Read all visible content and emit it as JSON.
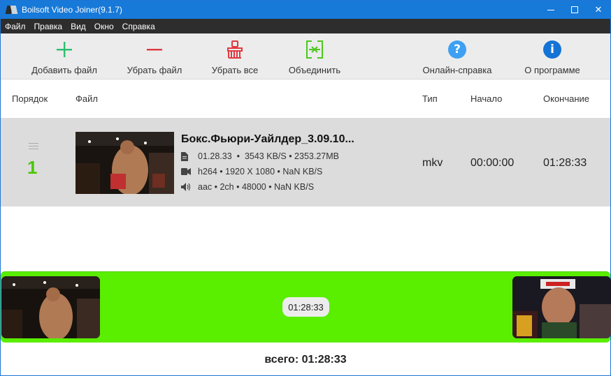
{
  "window": {
    "title": "Boilsoft Video Joiner(9.1.7)",
    "min_icon": "minimize-icon",
    "max_icon": "maximize-icon",
    "close_label": "✕"
  },
  "menu": [
    "Файл",
    "Правка",
    "Вид",
    "Окно",
    "Справка"
  ],
  "toolbar": {
    "add": {
      "label": "Добавить файл",
      "icon": "plus-icon",
      "color": "#2dbd6e"
    },
    "remove": {
      "label": "Убрать файл",
      "icon": "minus-icon",
      "color": "#e0393e"
    },
    "clear": {
      "label": "Убрать все",
      "icon": "broom-icon",
      "color": "#e0393e"
    },
    "join": {
      "label": "Объединить",
      "icon": "join-icon",
      "color": "#4cc81e"
    },
    "help": {
      "label": "Онлайн-справка",
      "icon": "help-icon",
      "glyph": "?",
      "color": "#3ea0f2"
    },
    "about": {
      "label": "О программе",
      "icon": "info-icon",
      "glyph": "i",
      "color": "#1573d6"
    }
  },
  "columns": {
    "order": "Порядок",
    "file": "Файл",
    "type": "Тип",
    "start": "Начало",
    "end": "Окончание"
  },
  "files": [
    {
      "order": "1",
      "name": "Бокс.Фьюри-Уайлдер_3.09.10...",
      "duration": "01.28.33",
      "bitrate": "3543 KB/S",
      "size": "2353.27MB",
      "video_codec": "h264",
      "resolution": "1920 X 1080",
      "video_bitrate": "NaN KB/S",
      "audio_codec": "aac",
      "channels": "2ch",
      "sample_rate": "48000",
      "audio_bitrate": "NaN KB/S",
      "type": "mkv",
      "start": "00:00:00",
      "end": "01:28:33"
    }
  ],
  "timeline": {
    "duration": "01:28:33",
    "color": "#5aee00"
  },
  "total": "всего: 01:28:33"
}
